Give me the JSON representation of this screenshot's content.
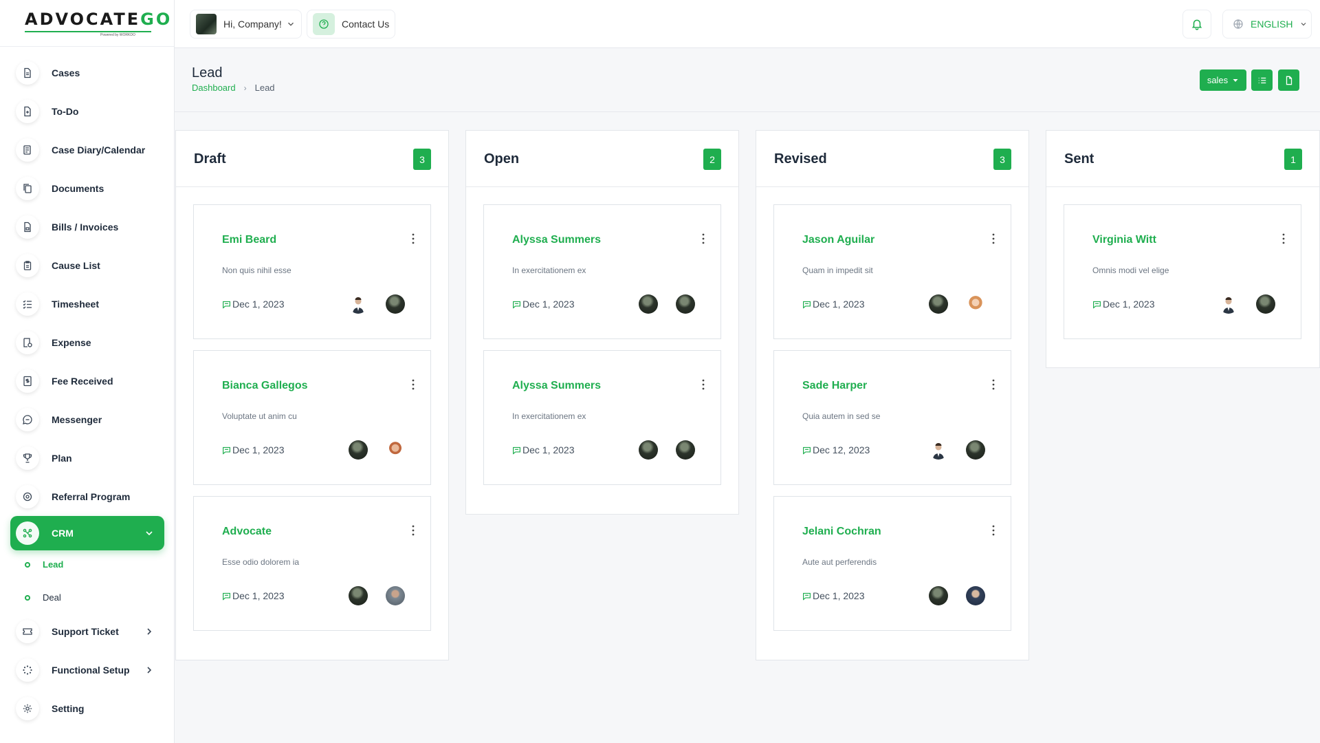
{
  "brand": {
    "logo_main": "ADVOCATE",
    "logo_accent": "GO",
    "logo_sub": "Powered by WORKDO"
  },
  "sidebar": {
    "items": [
      {
        "label": "Cases",
        "icon": "file-icon"
      },
      {
        "label": "To-Do",
        "icon": "file-plus-icon"
      },
      {
        "label": "Case Diary/Calendar",
        "icon": "notebook-icon"
      },
      {
        "label": "Documents",
        "icon": "copy-icon"
      },
      {
        "label": "Bills / Invoices",
        "icon": "invoice-icon"
      },
      {
        "label": "Cause List",
        "icon": "clipboard-icon"
      },
      {
        "label": "Timesheet",
        "icon": "list-check-icon"
      },
      {
        "label": "Expense",
        "icon": "receipt-icon"
      },
      {
        "label": "Fee Received",
        "icon": "dollar-file-icon"
      },
      {
        "label": "Messenger",
        "icon": "chat-icon"
      },
      {
        "label": "Plan",
        "icon": "trophy-icon"
      },
      {
        "label": "Referral Program",
        "icon": "settings-badge-icon"
      },
      {
        "label": "CRM",
        "icon": "crm-icon"
      },
      {
        "label": "Support Ticket",
        "icon": "ticket-icon"
      },
      {
        "label": "Functional Setup",
        "icon": "loader-icon"
      },
      {
        "label": "Setting",
        "icon": "gear-icon"
      }
    ],
    "crm_sub": [
      {
        "label": "Lead"
      },
      {
        "label": "Deal"
      }
    ]
  },
  "topbar": {
    "user_greeting": "Hi, Company!",
    "contact_label": "Contact Us",
    "language": "ENGLISH"
  },
  "page": {
    "title": "Lead",
    "breadcrumb_home": "Dashboard",
    "breadcrumb_current": "Lead",
    "pipeline_select": "sales"
  },
  "board": {
    "columns": [
      {
        "title": "Draft",
        "count": "3",
        "cards": [
          {
            "name": "Emi Beard",
            "desc": "Non quis nihil esse",
            "date": "Dec 1, 2023"
          },
          {
            "name": "Bianca Gallegos",
            "desc": "Voluptate ut anim cu",
            "date": "Dec 1, 2023"
          },
          {
            "name": "Advocate",
            "desc": "Esse odio dolorem ia",
            "date": "Dec 1, 2023"
          }
        ]
      },
      {
        "title": "Open",
        "count": "2",
        "cards": [
          {
            "name": "Alyssa Summers",
            "desc": "In exercitationem ex",
            "date": "Dec 1, 2023"
          },
          {
            "name": "Alyssa Summers",
            "desc": "In exercitationem ex",
            "date": "Dec 1, 2023"
          }
        ]
      },
      {
        "title": "Revised",
        "count": "3",
        "cards": [
          {
            "name": "Jason Aguilar",
            "desc": "Quam in impedit sit",
            "date": "Dec 1, 2023"
          },
          {
            "name": "Sade Harper",
            "desc": "Quia autem in sed se",
            "date": "Dec 12, 2023"
          },
          {
            "name": "Jelani Cochran",
            "desc": "Aute aut perferendis",
            "date": "Dec 1, 2023"
          }
        ]
      },
      {
        "title": "Sent",
        "count": "1",
        "cards": [
          {
            "name": "Virginia Witt",
            "desc": "Omnis modi vel elige",
            "date": "Dec 1, 2023"
          }
        ]
      }
    ]
  },
  "colors": {
    "accent": "#1fae4f",
    "text": "#1e2a3a",
    "muted": "#6b7582"
  }
}
